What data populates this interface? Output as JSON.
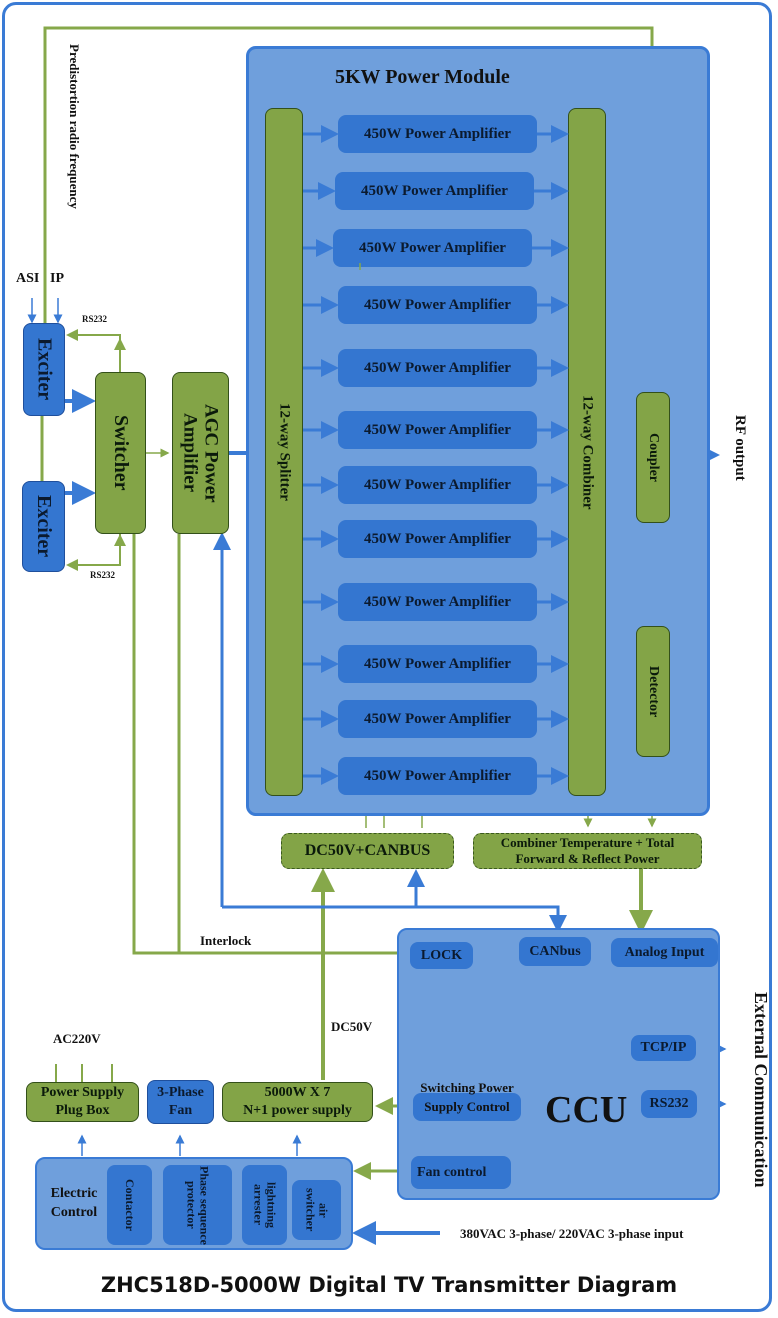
{
  "title": "ZHC518D-5000W Digital TV Transmitter Diagram",
  "labels": {
    "predistortion": "Predistortion radio frequency",
    "asi": "ASI",
    "ip": "IP",
    "rs232_top": "RS232",
    "rs232_bottom": "RS232",
    "rf_output": "RF output",
    "interlock": "Interlock",
    "dc50v": "DC50V",
    "ac220v": "AC220V",
    "external_communication": "External Communication",
    "power_input": "380VAC 3-phase/ 220VAC 3-phase input"
  },
  "blocks": {
    "exciter_1": "Exciter",
    "exciter_2": "Exciter",
    "switcher": "Switcher",
    "agc_amplifier": "AGC Power Amplifier",
    "power_module_title": "5KW Power Module",
    "splitter": "12-way Splitter",
    "combiner": "12-way Combiner",
    "coupler": "Coupler",
    "detector": "Detector",
    "dc50v_canbus": "DC50V+CANBUS",
    "combiner_temp": "Combiner Temperature + Total Forward & Reflect Power",
    "ccu": "CCU",
    "ccu_lock": "LOCK",
    "ccu_canbus": "CANbus",
    "ccu_analog_input": "Analog Input",
    "ccu_tcpip": "TCP/IP",
    "ccu_rs232": "RS232",
    "ccu_switching_ps": "Switching Power Supply Control",
    "ccu_fan_control": "Fan control",
    "plug_box": "Power Supply Plug Box",
    "fan": "3-Phase Fan",
    "power_supply_line1": "5000W X 7",
    "power_supply_line2": "N+1 power supply",
    "electric_control": "Electric Control",
    "contactor": "Contactor",
    "phase_protector": "Phase sequence protector",
    "lightning_arrester": "lightning arrester",
    "air_switcher": "air switcher"
  },
  "amplifiers": [
    "450W Power Amplifier",
    "450W Power Amplifier",
    "450W Power Amplifier",
    "450W Power Amplifier",
    "450W Power Amplifier",
    "450W Power Amplifier",
    "450W Power Amplifier",
    "450W Power Amplifier",
    "450W Power Amplifier",
    "450W Power Amplifier",
    "450W Power Amplifier",
    "450W Power Amplifier"
  ],
  "colors": {
    "blue": "#3476d0",
    "module_blue": "#6f9fdc",
    "green": "#83a447",
    "line_blue": "#3a7bd5",
    "line_green": "#86a84a"
  }
}
